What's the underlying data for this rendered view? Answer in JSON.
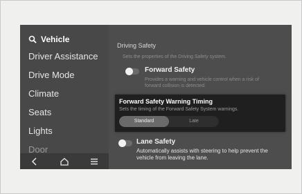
{
  "sidebar": {
    "search_label": "Vehicle",
    "items": [
      {
        "label": "Driver Assistance"
      },
      {
        "label": "Drive Mode"
      },
      {
        "label": "Climate"
      },
      {
        "label": "Seats"
      },
      {
        "label": "Lights"
      },
      {
        "label": "Door"
      }
    ],
    "bottom_icons": [
      "back-icon",
      "home-icon",
      "menu-icon"
    ]
  },
  "main": {
    "section_title": "Driving Safety",
    "section_desc": "Sets the properties of the Driving Safety system.",
    "forward_safety": {
      "title": "Forward Safety",
      "desc_line1": "Provides a warning and vehicle control when a risk of",
      "desc_line2": "forward collision is detected."
    },
    "popup": {
      "title": "Forward Safety Warning Timing",
      "desc": "Sets the timing of the Forward Safety System warnings.",
      "options": [
        "Standard",
        "Late"
      ],
      "selected": "Standard"
    },
    "lane_safety": {
      "title": "Lane Safety",
      "desc_line1": "Automatically assists with steering to help prevent the",
      "desc_line2": "vehicle from leaving the lane."
    }
  }
}
